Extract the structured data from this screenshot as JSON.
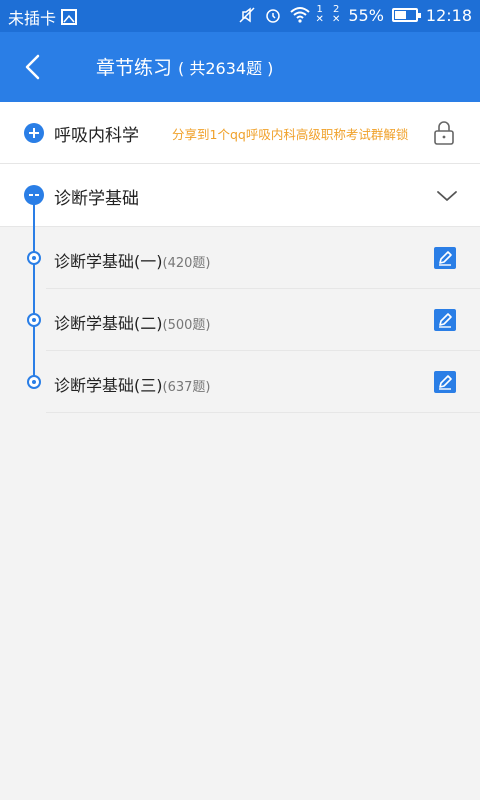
{
  "status_bar": {
    "carrier": "未插卡",
    "battery": "55%",
    "battery_level": 0.55,
    "time": "12:18",
    "sim1": "1",
    "sim2": "2"
  },
  "header": {
    "title": "章节练习",
    "subtitle": "( 共2634题 )"
  },
  "subject": {
    "title": "呼吸内科学",
    "share_note": "分享到1个qq呼吸内科高级职称考试群解锁"
  },
  "chapter": {
    "title": "诊断学基础"
  },
  "items": [
    {
      "label": "诊断学基础(一)",
      "count": "(420题)"
    },
    {
      "label": "诊断学基础(二)",
      "count": "(500题)"
    },
    {
      "label": "诊断学基础(三)",
      "count": "(637题)"
    }
  ],
  "colors": {
    "primary": "#2a7ee6",
    "status_bar": "#1e6fd6",
    "note": "#f0a12a",
    "background": "#f3f3f3"
  },
  "icons": {
    "back": "chevron-left-icon",
    "expand": "plus-circle-icon",
    "collapse": "minus-circle-icon",
    "lock": "lock-icon",
    "chevron": "chevron-down-icon",
    "edit": "pencil-icon"
  }
}
